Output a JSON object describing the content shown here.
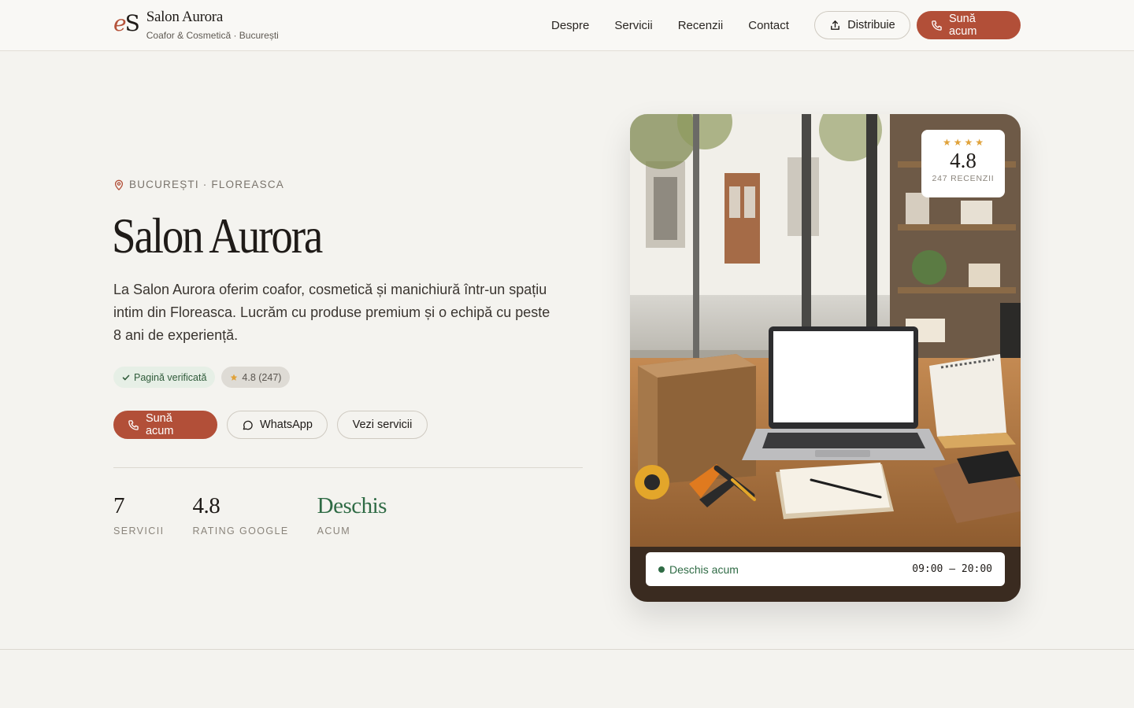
{
  "brand": {
    "logo_e": "e",
    "logo_s": "S",
    "name": "Salon Aurora",
    "subtitle": "Coafor & Cosmetică · București"
  },
  "nav": {
    "items": [
      {
        "label": "Despre"
      },
      {
        "label": "Servicii"
      },
      {
        "label": "Recenzii"
      },
      {
        "label": "Contact"
      }
    ]
  },
  "header": {
    "share_label": "Distribuie",
    "call_label": "Sună acum"
  },
  "hero": {
    "location": "BUCUREȘTI · FLOREASCA",
    "title": "Salon Aurora",
    "description": "La Salon Aurora oferim coafor, cosmetică și manichiură într-un spațiu intim din Floreasca. Lucrăm cu produse premium și o echipă cu peste 8 ani de experiență.",
    "badges": {
      "verified": "Pagină verificată",
      "rating": "4.8 (247)"
    },
    "actions": {
      "call": "Sună acum",
      "whatsapp": "WhatsApp",
      "services": "Vezi servicii"
    },
    "stats": [
      {
        "value": "7",
        "label": "SERVICII"
      },
      {
        "value": "4.8",
        "label": "RATING GOOGLE"
      },
      {
        "value": "Deschis",
        "label": "ACUM"
      }
    ]
  },
  "photo_card": {
    "rating_stars": 4,
    "rating_value": "4.8",
    "rating_count": "247 RECENZII",
    "status": "Deschis acum",
    "hours": "09:00 — 20:00"
  },
  "colors": {
    "accent": "#b24f38",
    "open_green": "#2f6b45",
    "background": "#f4f3ef",
    "star": "#e0a23a"
  }
}
